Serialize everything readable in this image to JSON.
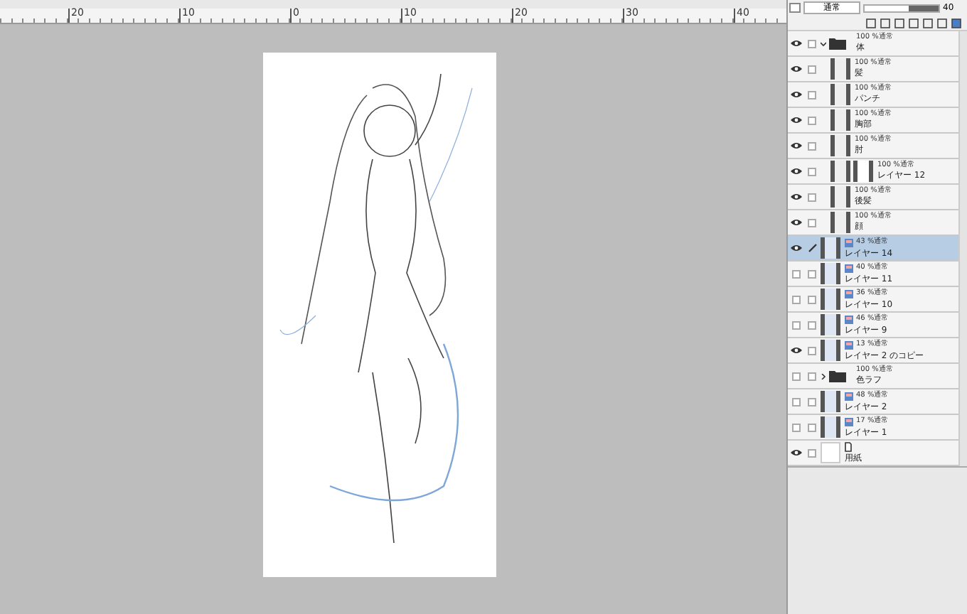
{
  "ruler": {
    "labels": [
      "20",
      "10",
      "0",
      "10",
      "20",
      "30",
      "40"
    ]
  },
  "layer_toolbar": {
    "blend_mode": "通常",
    "opacity": {
      "level": 0.4,
      "reading": "40"
    }
  },
  "layers": [
    {
      "kind": "folder",
      "name": "体",
      "mode": "100 %通常",
      "visible": true,
      "selected": false,
      "expanded": true,
      "children": [
        {
          "kind": "layer",
          "name": "髪",
          "mode": "100 %通常",
          "visible": true,
          "selected": false,
          "has_type_icon": false,
          "mask": false
        },
        {
          "kind": "layer",
          "name": "パンチ",
          "mode": "100 %通常",
          "visible": true,
          "selected": false,
          "has_type_icon": false,
          "mask": false
        },
        {
          "kind": "layer",
          "name": "胸部",
          "mode": "100 %通常",
          "visible": true,
          "selected": false,
          "has_type_icon": false,
          "mask": false
        },
        {
          "kind": "layer",
          "name": "肘",
          "mode": "100 %通常",
          "visible": true,
          "selected": false,
          "has_type_icon": false,
          "mask": false
        },
        {
          "kind": "layer",
          "name": "レイヤー 12",
          "mode": "100 %通常",
          "visible": true,
          "selected": false,
          "has_type_icon": false,
          "mask": true
        },
        {
          "kind": "layer",
          "name": "後髪",
          "mode": "100 %通常",
          "visible": true,
          "selected": false,
          "has_type_icon": false,
          "mask": false
        },
        {
          "kind": "layer",
          "name": "顔",
          "mode": "100 %通常",
          "visible": true,
          "selected": false,
          "has_type_icon": false,
          "mask": false
        }
      ]
    },
    {
      "kind": "layer",
      "name": "レイヤー 14",
      "mode": "43 %通常",
      "visible": true,
      "selected": true,
      "has_type_icon": true,
      "mask": false
    },
    {
      "kind": "layer",
      "name": "レイヤー 11",
      "mode": "40 %通常",
      "visible": false,
      "selected": false,
      "has_type_icon": true,
      "mask": false
    },
    {
      "kind": "layer",
      "name": "レイヤー 10",
      "mode": "36 %通常",
      "visible": false,
      "selected": false,
      "has_type_icon": true,
      "mask": false
    },
    {
      "kind": "layer",
      "name": "レイヤー 9",
      "mode": "46 %通常",
      "visible": false,
      "selected": false,
      "has_type_icon": true,
      "mask": false
    },
    {
      "kind": "layer",
      "name": "レイヤー 2 のコピー",
      "mode": "13 %通常",
      "visible": true,
      "selected": false,
      "has_type_icon": true,
      "mask": false
    },
    {
      "kind": "folder",
      "name": "色ラフ",
      "mode": "100 %通常",
      "visible": false,
      "selected": false,
      "expanded": false
    },
    {
      "kind": "layer",
      "name": "レイヤー 2",
      "mode": "48 %通常",
      "visible": false,
      "selected": false,
      "has_type_icon": true,
      "mask": false
    },
    {
      "kind": "layer",
      "name": "レイヤー 1",
      "mode": "17 %通常",
      "visible": false,
      "selected": false,
      "has_type_icon": true,
      "mask": false
    },
    {
      "kind": "paper",
      "name": "用紙",
      "visible": true,
      "selected": false
    }
  ]
}
